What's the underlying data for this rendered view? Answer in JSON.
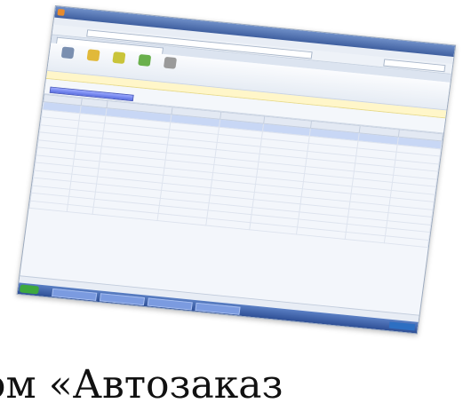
{
  "window": {
    "title": "",
    "menu": [
      "",
      "",
      "",
      "",
      ""
    ],
    "address": "",
    "tab": ""
  },
  "toolbar": {
    "buttons": [
      {
        "label": "",
        "color": "#7a8fb0",
        "icon": "folder-icon"
      },
      {
        "label": "",
        "color": "#e1b93a",
        "icon": "pencil-icon"
      },
      {
        "label": "",
        "color": "#c9c43a",
        "icon": "filter-icon"
      },
      {
        "label": "",
        "color": "#6ab04c",
        "icon": "refresh-icon"
      },
      {
        "label": "",
        "color": "#9a9a9a",
        "icon": "tools-icon"
      }
    ]
  },
  "grid": {
    "columns": [
      "",
      "",
      "",
      "",
      "",
      "",
      "",
      "",
      ""
    ],
    "rows": 14,
    "selected_row": 0
  },
  "caption": {
    "text": "ом «Автозаказ"
  },
  "colors": {
    "accent": "#5b6fe0",
    "titlebar": "#3f5f9f",
    "taskbar": "#2e4f95"
  }
}
